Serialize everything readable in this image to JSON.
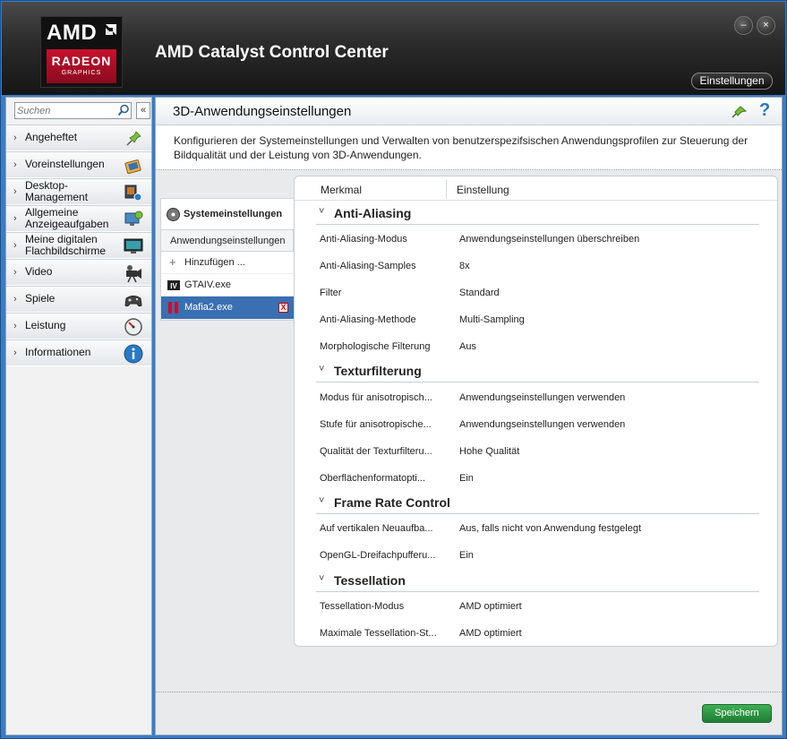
{
  "header": {
    "brand": "AMD",
    "brand_sub": "RADEON",
    "brand_sub2": "GRAPHICS",
    "app_title": "AMD Catalyst Control Center",
    "settings_label": "Einstellungen",
    "minimize_glyph": "–",
    "close_glyph": "×"
  },
  "sidebar": {
    "search_placeholder": "Suchen",
    "collapse_glyph": "«",
    "items": [
      {
        "label": "Angeheftet",
        "icon": "pin-icon"
      },
      {
        "label": "Voreinstellungen",
        "icon": "presets-icon"
      },
      {
        "label": "Desktop-\nManagement",
        "icon": "desktop-management-icon"
      },
      {
        "label": "Allgemeine\nAnzeigeaufgaben",
        "icon": "display-tasks-icon"
      },
      {
        "label": "Meine digitalen\nFlachbildschirme",
        "icon": "flat-panel-icon"
      },
      {
        "label": "Video",
        "icon": "video-camera-icon"
      },
      {
        "label": "Spiele",
        "icon": "gamepad-icon"
      },
      {
        "label": "Leistung",
        "icon": "gauge-icon"
      },
      {
        "label": "Informationen",
        "icon": "info-icon"
      }
    ]
  },
  "main": {
    "title": "3D-Anwendungseinstellungen",
    "help_glyph": "?",
    "description": "Konfigurieren der Systemeinstellungen und Verwalten von benutzerspezifsischen Anwendungsprofilen zur Steuerung der Bildqualität und der Leistung von 3D-Anwendungen.",
    "tabs": {
      "system": "Systemeinstellungen",
      "application": "Anwendungseinstellungen",
      "add": "Hinzufügen ...",
      "apps": [
        {
          "label": "GTAIV.exe",
          "selected": false
        },
        {
          "label": "Mafia2.exe",
          "selected": true
        }
      ],
      "delete_glyph": "X"
    },
    "table": {
      "col_feature": "Merkmal",
      "col_setting": "Einstellung",
      "groups": [
        {
          "title": "Anti-Aliasing",
          "rows": [
            {
              "name": "Anti-Aliasing-Modus",
              "value": "Anwendungseinstellungen überschreiben"
            },
            {
              "name": "Anti-Aliasing-Samples",
              "value": "8x"
            },
            {
              "name": "Filter",
              "value": "Standard"
            },
            {
              "name": "Anti-Aliasing-Methode",
              "value": "Multi-Sampling"
            },
            {
              "name": "Morphologische Filterung",
              "value": "Aus"
            }
          ]
        },
        {
          "title": "Texturfilterung",
          "rows": [
            {
              "name": "Modus für anisotropisch...",
              "value": "Anwendungseinstellungen verwenden"
            },
            {
              "name": "Stufe für anisotropische...",
              "value": "Anwendungseinstellungen verwenden"
            },
            {
              "name": "Qualität der Texturfilteru...",
              "value": "Hohe Qualität"
            },
            {
              "name": "Oberflächenformatopti...",
              "value": "Ein"
            }
          ]
        },
        {
          "title": "Frame Rate Control",
          "rows": [
            {
              "name": "Auf vertikalen Neuaufba...",
              "value": "Aus, falls nicht von Anwendung festgelegt"
            },
            {
              "name": "OpenGL-Dreifachpufferu...",
              "value": "Ein"
            }
          ]
        },
        {
          "title": "Tessellation",
          "rows": [
            {
              "name": "Tessellation-Modus",
              "value": "AMD optimiert"
            },
            {
              "name": "Maximale Tessellation-St...",
              "value": "AMD optimiert"
            }
          ]
        }
      ]
    },
    "save_label": "Speichern"
  },
  "colors": {
    "accent_blue": "#3a6fb2",
    "frame_blue": "#3b7cc6",
    "amd_red": "#c8102e",
    "save_green": "#2e9644"
  }
}
